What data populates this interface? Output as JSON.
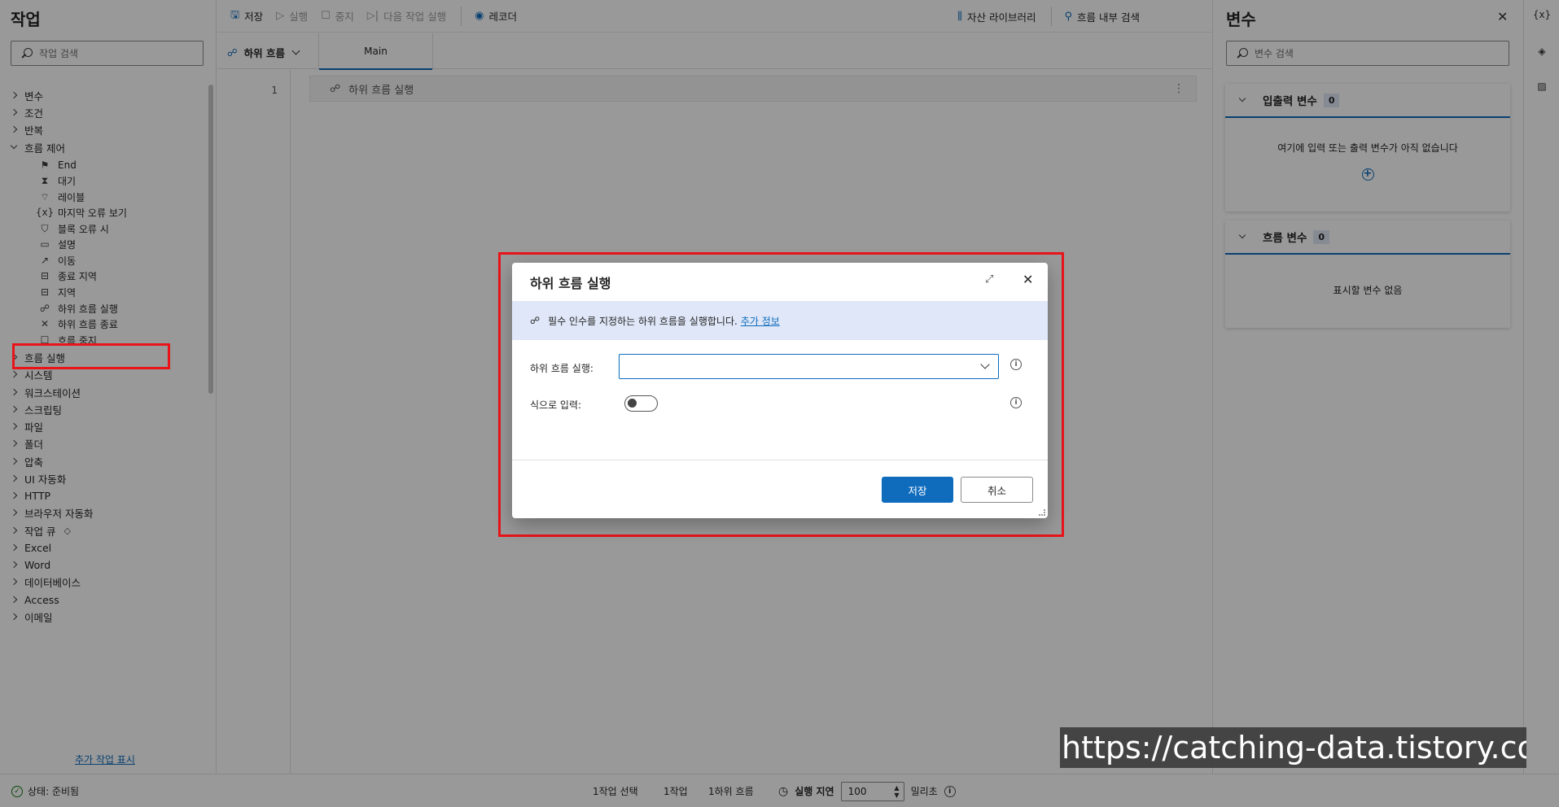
{
  "actions": {
    "title": "작업",
    "search_placeholder": "작업 검색",
    "categories_top": [
      "변수",
      "조건",
      "반복"
    ],
    "flow_control": "흐름 제어",
    "flow_items": [
      "End",
      "대기",
      "레이블",
      "마지막 오류 보기",
      "블록 오류 시",
      "설명",
      "이동",
      "종료 지역",
      "지역",
      "하위 흐름 실행",
      "하위 흐름 종료",
      "흐름 중지"
    ],
    "categories_bottom": [
      "흐름 실행",
      "시스템",
      "워크스테이션",
      "스크립팅",
      "파일",
      "폴더",
      "압축",
      "UI 자동화",
      "HTTP",
      "브라우저 자동화",
      "작업 큐",
      "Excel",
      "Word",
      "데이터베이스",
      "Access",
      "이메일"
    ],
    "more_link": "추가 작업 표시"
  },
  "toolbar": {
    "save": "저장",
    "run": "실행",
    "stop": "중지",
    "run_next": "다음 작업 실행",
    "recorder": "레코더",
    "asset_library": "자산 라이브러리",
    "search_in_flow": "흐름 내부 검색"
  },
  "tabs": {
    "subflows": "하위 흐름",
    "main": "Main"
  },
  "canvas": {
    "line_number": "1",
    "step_text": "하위 흐름 실행"
  },
  "variables": {
    "title": "변수",
    "search_placeholder": "변수 검색",
    "io_section": "입출력 변수",
    "io_count": "0",
    "io_empty": "여기에 입력 또는 출력 변수가 아직 없습니다",
    "flow_section": "흐름 변수",
    "flow_count": "0",
    "flow_empty": "표시할 변수 없음",
    "rail_label": "{x}"
  },
  "status": {
    "state": "상태: 준비됨",
    "selected": "1작업 선택",
    "actions": "1작업",
    "subflows": "1하위 흐름",
    "delay_label": "실행 지연",
    "delay_value": "100",
    "unit": "밀리초"
  },
  "dialog": {
    "title": "하위 흐름 실행",
    "info_text": "필수 인수를 지정하는 하위 흐름을 실행합니다.",
    "info_link": "추가 정보",
    "field_label": "하위 흐름 실행:",
    "field_value": "",
    "toggle_label": "식으로 입력:",
    "toggle_on": false,
    "save": "저장",
    "cancel": "취소"
  },
  "watermark": "https://catching-data.tistory.com",
  "colors": {
    "accent": "#0f6cbd",
    "highlight": "#e8141a",
    "info_bar": "#dfe7f8"
  }
}
